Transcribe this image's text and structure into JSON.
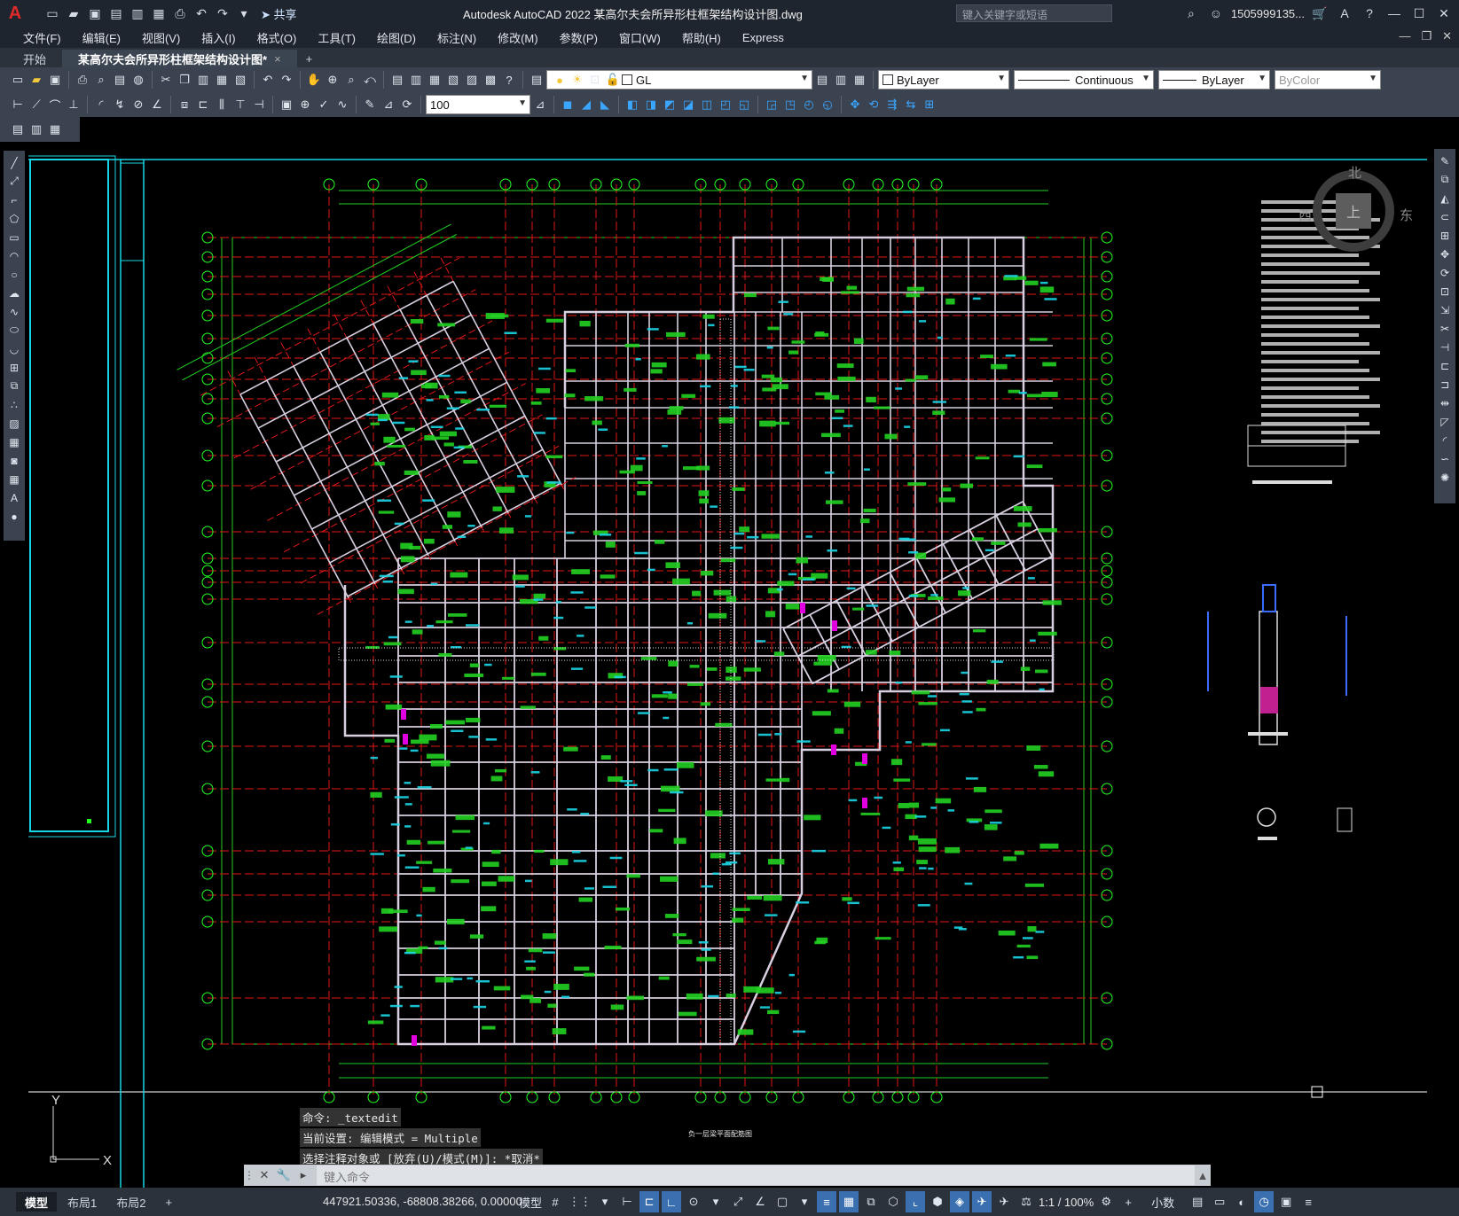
{
  "titlebar": {
    "app_logo": "A",
    "title": "Autodesk AutoCAD 2022    某高尔夫会所异形柱框架结构设计图.dwg",
    "share_label": "共享",
    "search_placeholder": "键入关键字或短语",
    "user": "1505999135...",
    "icons": [
      "new-icon",
      "open-icon",
      "save-icon",
      "saveas-icon",
      "open-web-icon",
      "save-web-icon",
      "plot-icon",
      "undo-icon",
      "redo-icon",
      "customize-icon"
    ]
  },
  "menubar": {
    "items": [
      "文件(F)",
      "编辑(E)",
      "视图(V)",
      "插入(I)",
      "格式(O)",
      "工具(T)",
      "绘图(D)",
      "标注(N)",
      "修改(M)",
      "参数(P)",
      "窗口(W)",
      "帮助(H)",
      "Express"
    ]
  },
  "tabs": {
    "start": "开始",
    "active": "某高尔夫会所异形柱框架结构设计图*",
    "close": "×",
    "plus": "+"
  },
  "toolbar1": {
    "layer_name": "GL",
    "color": "ByLayer",
    "linetype": "Continuous",
    "lineweight": "ByLayer",
    "plotstyle": "ByColor"
  },
  "toolbar2": {
    "scale": "100"
  },
  "compass": {
    "north": "北",
    "west": "西",
    "east": "东",
    "top": "上"
  },
  "drawing": {
    "bottom_title": "负一层梁平面配筋图",
    "ucs_y": "Y",
    "ucs_x": "X"
  },
  "command": {
    "history": [
      "命令:  _textedit",
      "当前设置: 编辑模式 = Multiple",
      "选择注释对象或 [放弃(U)/模式(M)]: *取消*"
    ],
    "placeholder": "键入命令"
  },
  "statusbar": {
    "layouts": [
      "模型",
      "布局1",
      "布局2"
    ],
    "plus": "+",
    "coords": "447921.50336, -68808.38266, 0.00000",
    "mode": "模型",
    "annotation_scale": "1:1 / 100%",
    "units": "小数"
  },
  "colors": {
    "grid_red": "#e01818",
    "dim_green": "#22d022",
    "beam_white": "#d8cfe0",
    "cyan": "#19d6e6",
    "magenta": "#e000e0",
    "axis_bubble": "#22ff22"
  }
}
